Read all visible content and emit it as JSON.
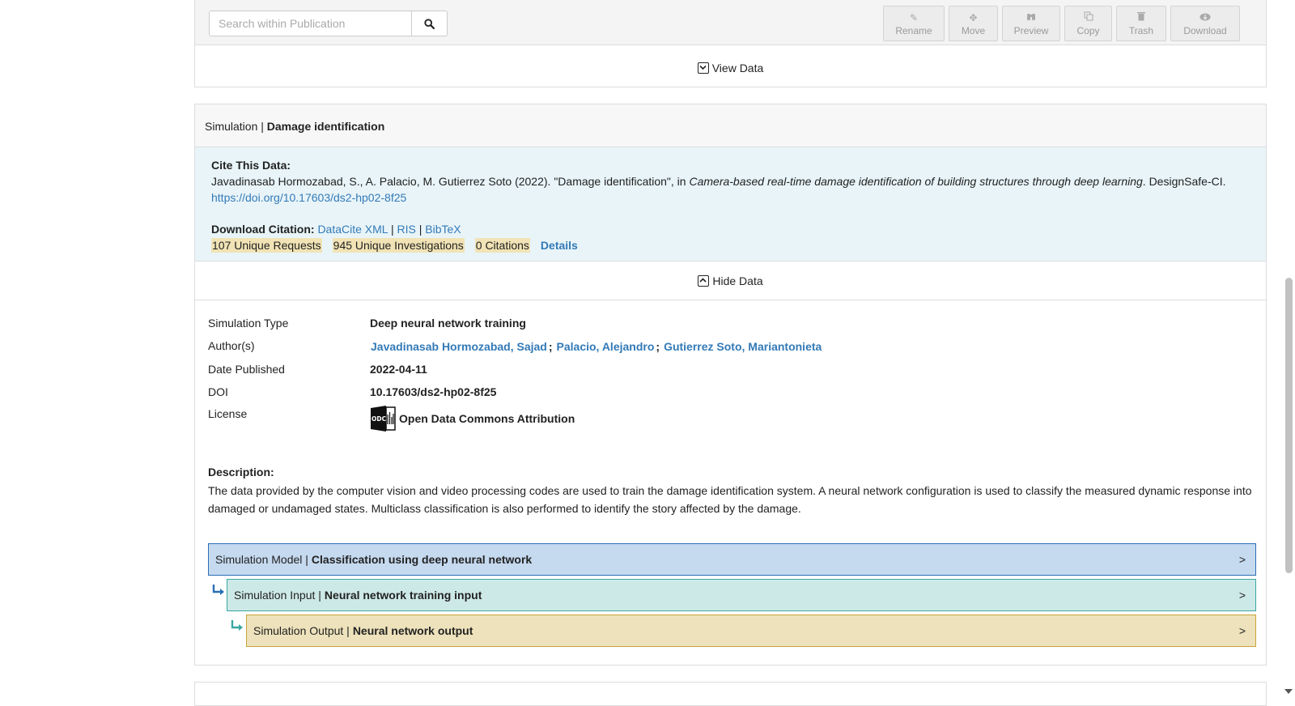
{
  "toolbar": {
    "search_placeholder": "Search within Publication",
    "buttons": [
      {
        "label": "Rename",
        "icon": "pencil-icon"
      },
      {
        "label": "Move",
        "icon": "move-arrows-icon"
      },
      {
        "label": "Preview",
        "icon": "binoculars-icon"
      },
      {
        "label": "Copy",
        "icon": "copy-icon"
      },
      {
        "label": "Trash",
        "icon": "trash-icon"
      },
      {
        "label": "Download",
        "icon": "cloud-download-icon"
      }
    ],
    "view_data_label": "View Data"
  },
  "simulation": {
    "prefix": "Simulation | ",
    "title": "Damage identification",
    "cite": {
      "heading": "Cite This Data:",
      "authors_year": "Javadinasab Hormozabad, S., A. Palacio, M. Gutierrez Soto (2022). \"Damage identification\", in ",
      "project_title": "Camera-based real-time damage identification of building structures through deep learning",
      "publisher": ". DesignSafe-CI.",
      "doi_url": "https://doi.org/10.17603/ds2-hp02-8f25",
      "download_label": "Download Citation:",
      "formats": [
        "DataCite XML",
        "RIS",
        "BibTeX"
      ],
      "metrics": [
        "107 Unique Requests",
        "945 Unique Investigations",
        "0 Citations"
      ],
      "details_label": "Details"
    },
    "hide_data_label": "Hide Data",
    "fields": {
      "type_label": "Simulation Type",
      "type_value": "Deep neural network training",
      "authors_label": "Author(s)",
      "authors": [
        "Javadinasab Hormozabad, Sajad",
        "Palacio, Alejandro",
        "Gutierrez Soto, Mariantonieta"
      ],
      "date_label": "Date Published",
      "date_value": "2022-04-11",
      "doi_label": "DOI",
      "doi_value": "10.17603/ds2-hp02-8f25",
      "license_label": "License",
      "license_value": "Open Data Commons Attribution"
    },
    "description": {
      "heading": "Description:",
      "text": "The data provided by the computer vision and video processing codes are used to train the damage identification system. A neural network configuration is used to classify the measured dynamic response into damaged or undamaged states. Multiclass classification is also performed to identify the story affected by the damage."
    },
    "tree": [
      {
        "prefix": "Simulation Model | ",
        "title": "Classification using deep neural network",
        "color": "#c5d9ef"
      },
      {
        "prefix": "Simulation Input | ",
        "title": "Neural network training input",
        "color": "#cde9e7"
      },
      {
        "prefix": "Simulation Output | ",
        "title": "Neural network output",
        "color": "#ede2bb"
      }
    ]
  },
  "colors": {
    "link": "#337ab7",
    "metric_bg": "#f1e3b5",
    "cite_bg": "#e8f4f8"
  }
}
